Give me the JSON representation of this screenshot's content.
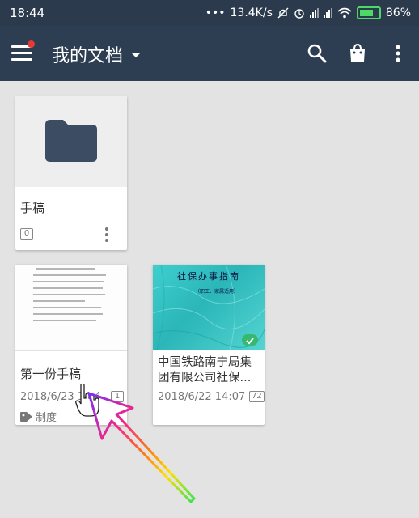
{
  "status_bar": {
    "time": "18:44",
    "dots": "•••",
    "speed": "13.4K/s",
    "battery": "86%"
  },
  "app_bar": {
    "title": "我的文档",
    "colors": {
      "background": "#2e3e52",
      "notification_dot": "#e53935"
    }
  },
  "items": [
    {
      "type": "folder",
      "title": "手稿",
      "count": "0"
    },
    {
      "type": "document",
      "title": "第一份手稿",
      "date": "2018/6/23 14:4",
      "count": "1",
      "tag": "制度"
    },
    {
      "type": "document",
      "title": "中国铁路南宁局集团有限公司社保...",
      "date": "2018/6/22 14:07",
      "count": "72",
      "cover_title": "社保办事指南",
      "cover_subtitle": "（职工、家属适用）"
    }
  ]
}
